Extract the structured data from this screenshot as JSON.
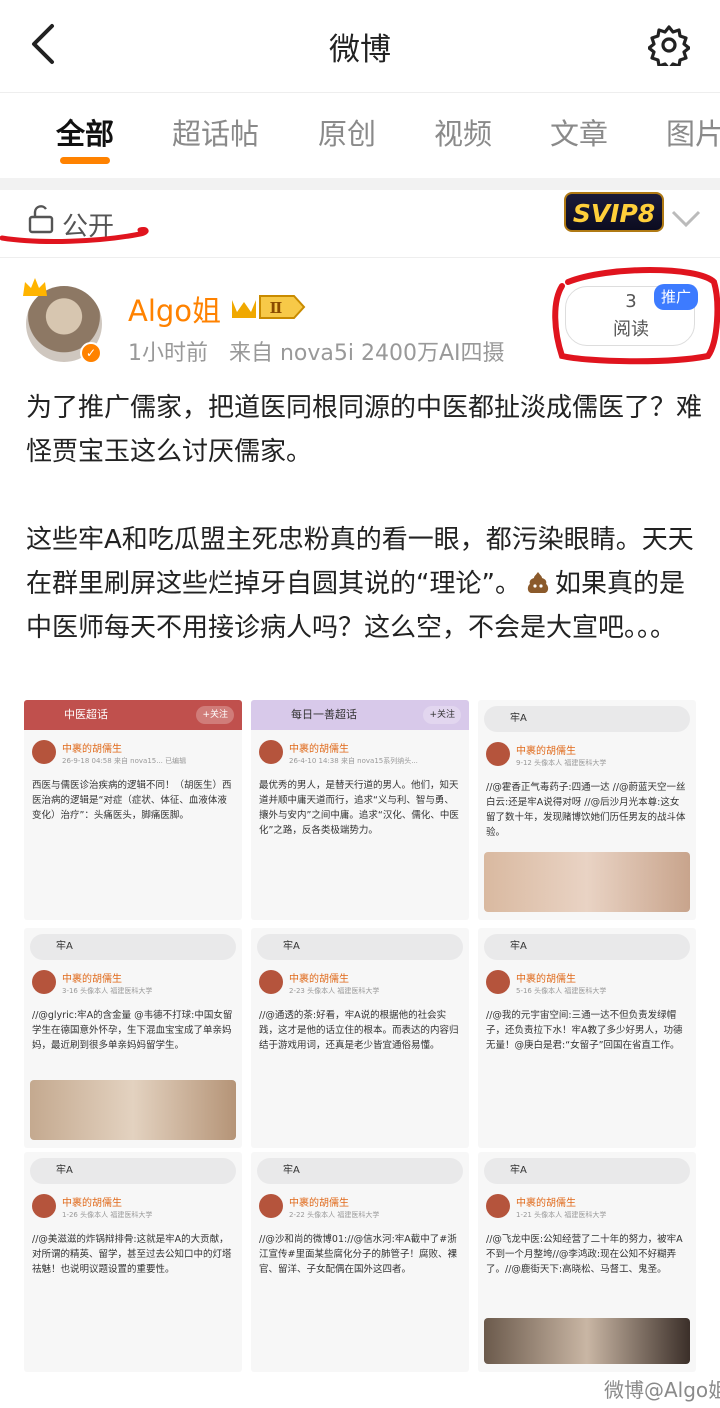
{
  "header": {
    "title": "微博"
  },
  "tabs": [
    {
      "label": "全部"
    },
    {
      "label": "超话帖"
    },
    {
      "label": "原创"
    },
    {
      "label": "视频"
    },
    {
      "label": "文章"
    },
    {
      "label": "图片"
    }
  ],
  "visibility": {
    "label": "公开",
    "svip_badge": "SVIP8"
  },
  "post": {
    "username": "Algo姐",
    "level_badge": "Ⅱ",
    "time": "1小时前",
    "source": "来自 nova5i 2400万AI四摄",
    "read_count": "3",
    "read_label": "阅读",
    "promo_tag": "推广",
    "paragraph1": "为了推广儒家，把道医同根同源的中医都扯淡成儒医了？难怪贾宝玉这么讨厌儒家。",
    "paragraph2_a": "这些牢A和吃瓜盟主死忠粉真的看一眼，都污染眼睛。天天在群里刷屏这些烂掉牙自圆其说的“理论”。",
    "paragraph2_b": "如果真的是中医师每天不用接诊病人吗？这么空，不会是大宣吧。。。"
  },
  "grid": [
    {
      "head": "中医超话",
      "follow": "+关注",
      "name": "中裹的胡儒生",
      "sub": "26-9-18 04:58 来自 nova15... 已编辑",
      "body": "西医与儒医诊治疾病的逻辑不同！（胡医生）西医治病的逻辑是“对症（症状、体征、血液体液变化）治疗”：头痛医头，脚痛医脚。"
    },
    {
      "head": "每日一善超话",
      "follow": "+关注",
      "name": "中裹的胡儒生",
      "sub": "26-4-10 14:38 来自 nova15系列纳头...",
      "body": "最优秀的男人，是替天行道的男人。他们，知天道并顺中庸天道而行，追求“义与利、智与勇、攘外与安内”之间中庸。追求“汉化、儒化、中医化”之路，反各类极端势力。"
    },
    {
      "search": "牢A",
      "name": "中裹的胡儒生",
      "sub": "9-12 头像本人 福建医科大学",
      "body": "//@霍香正气毒药子:四通一达 //@蔚蓝天空一丝白云:还是牢A说得对呀 //@后沙月光本尊:这女留了数十年，发现赌博饮她们历任男友的战斗体验。"
    },
    {
      "search": "牢A",
      "name": "中裹的胡儒生",
      "sub": "3-16 头像本人 福建医科大学",
      "body": "//@glyric:牢A的含金量 @韦德不打球:中国女留学生在德国意外怀孕，生下混血宝宝成了单亲妈妈，最近刷到很多单亲妈妈留学生。"
    },
    {
      "search": "牢A",
      "name": "中裹的胡儒生",
      "sub": "2-23 头像本人 福建医科大学",
      "body": "//@通透的茶:好看，牢A说的根据他的社会实践，这才是他的话立住的根本。而表达的内容归结于游戏用词，还真是老少皆宜通俗易懂。"
    },
    {
      "search": "牢A",
      "name": "中裹的胡儒生",
      "sub": "5-16 头像本人 福建医科大学",
      "body": "//@我的元宇宙空间:三通一达不但负责发绿帽子，还负责拉下水！牢A教了多少好男人，功德无量！@庚白是君:“女留子”回国在省直工作。"
    },
    {
      "search": "牢A",
      "name": "中裹的胡儒生",
      "sub": "1-26 头像本人 福建医科大学",
      "body": "//@美滋滋的炸锅辩排骨:这就是牢A的大贡献，对所谓的精英、留学，甚至过去公知口中的灯塔祛魅！也说明议题设置的重要性。"
    },
    {
      "search": "牢A",
      "name": "中裹的胡儒生",
      "sub": "2-22 头像本人 福建医科大学",
      "body": "//@沙和尚的微博01://@信水河:牢A截中了#浙江宣传#里面某些腐化分子的肺管子！腐败、裸官、留洋、子女配偶在国外这四者。"
    },
    {
      "search": "牢A",
      "name": "中裹的胡儒生",
      "sub": "1-21 头像本人 福建医科大学",
      "body": "//@飞龙中医:公知经营了二十年的努力，被牢A不到一个月整垮//@李鸿政:现在公知不好糊弄了。//@鹿街天下:高晓松、马督工、鬼圣。"
    }
  ],
  "watermark": "微博@Algo姐"
}
